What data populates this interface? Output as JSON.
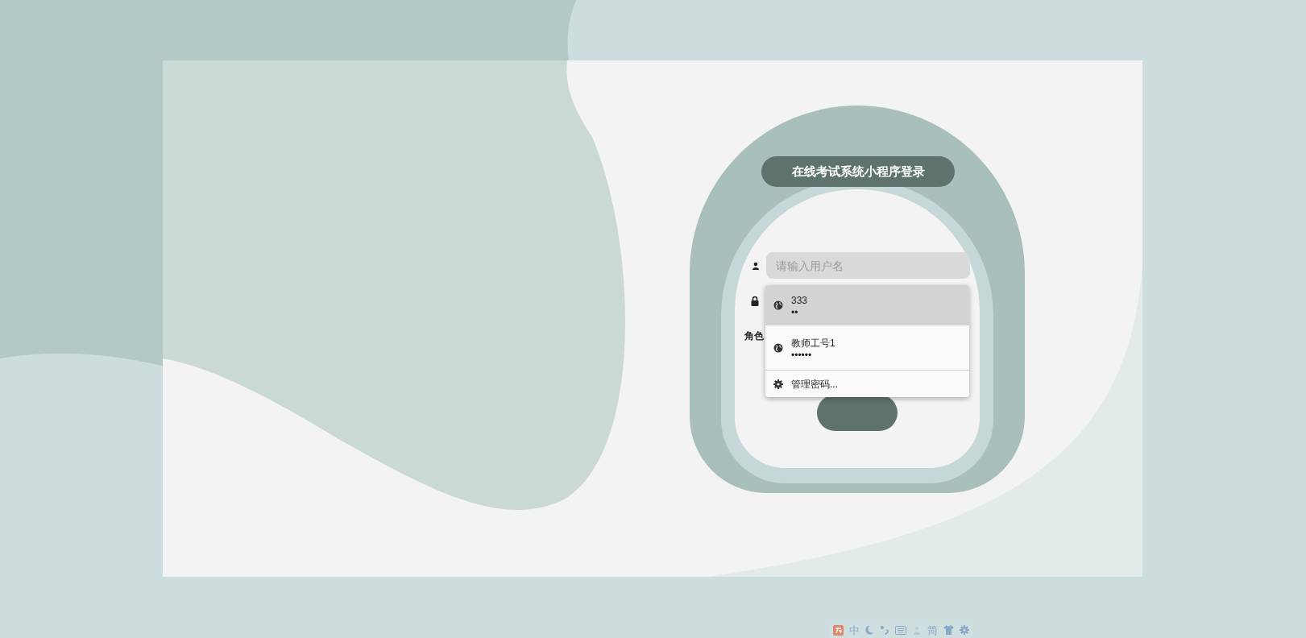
{
  "login": {
    "title": "在线考试系统小程序登录",
    "username": {
      "placeholder": "请输入用户名"
    },
    "role_label": "角色"
  },
  "autofill": [
    {
      "kind": "credential",
      "username": "333",
      "password": "••",
      "selected": true
    },
    {
      "kind": "credential",
      "username": "教师工号1",
      "password": "••••••",
      "selected": false
    },
    {
      "kind": "manage",
      "label": "管理密码..."
    }
  ],
  "ime_toolbar": {
    "mode": "中",
    "script": "简"
  }
}
